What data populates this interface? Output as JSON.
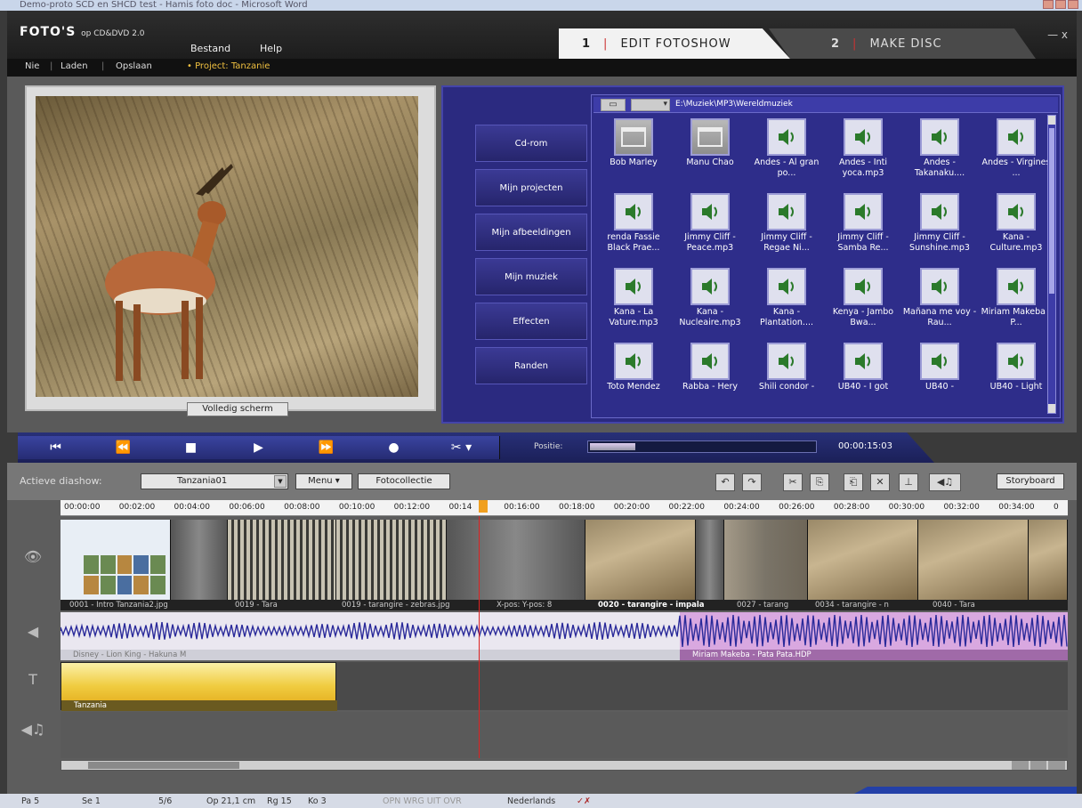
{
  "window": {
    "title": "Demo-proto SCD en SHCD test - Hamis foto doc - Microsoft Word"
  },
  "app": {
    "logo": "FOTO'S",
    "logo_sub": "op CD&DVD 2.0",
    "menu": [
      "Bestand",
      "Help"
    ],
    "tabs": [
      {
        "num": "1",
        "label": "EDIT FOTOSHOW"
      },
      {
        "num": "2",
        "label": "MAKE DISC"
      }
    ],
    "close_symbol": "— x",
    "subbar": {
      "nie": "Nie",
      "laden": "Laden",
      "opslaan": "Opslaan",
      "project": "• Project: Tanzanie"
    }
  },
  "preview": {
    "fullscreen_label": "Volledig scherm"
  },
  "browser": {
    "nav": [
      "Cd-rom",
      "Mijn projecten",
      "Mijn afbeeldingen",
      "Mijn muziek",
      "Effecten",
      "Randen"
    ],
    "path": "E:\\Muziek\\MP3\\Wereldmuziek",
    "folder_btn": "▭",
    "drop_btn": "▾",
    "items": [
      {
        "label": "Bob Marley",
        "type": "folder"
      },
      {
        "label": "Manu Chao",
        "type": "folder"
      },
      {
        "label": "Andes - Al gran po...",
        "type": "audio"
      },
      {
        "label": "Andes - Inti yoca.mp3",
        "type": "audio"
      },
      {
        "label": "Andes - Takanaku....",
        "type": "audio"
      },
      {
        "label": "Andes - Virgines ...",
        "type": "audio"
      },
      {
        "label": "renda Fassie Black Prae...",
        "type": "audio"
      },
      {
        "label": "Jimmy Cliff - Peace.mp3",
        "type": "audio"
      },
      {
        "label": "Jimmy Cliff - Regae Ni...",
        "type": "audio"
      },
      {
        "label": "Jimmy Cliff - Samba Re...",
        "type": "audio"
      },
      {
        "label": "Jimmy Cliff - Sunshine.mp3",
        "type": "audio"
      },
      {
        "label": "Kana - Culture.mp3",
        "type": "audio"
      },
      {
        "label": "Kana - La Vature.mp3",
        "type": "audio"
      },
      {
        "label": "Kana - Nucleaire.mp3",
        "type": "audio"
      },
      {
        "label": "Kana - Plantation....",
        "type": "audio"
      },
      {
        "label": "Kenya - Jambo Bwa...",
        "type": "audio"
      },
      {
        "label": "Mañana me voy - Rau...",
        "type": "audio"
      },
      {
        "label": "Miriam Makeba - P...",
        "type": "audio"
      },
      {
        "label": "Toto Mendez",
        "type": "audio"
      },
      {
        "label": "Rabba - Hery",
        "type": "audio"
      },
      {
        "label": "Shili condor -",
        "type": "audio"
      },
      {
        "label": "UB40 - I got",
        "type": "audio"
      },
      {
        "label": "UB40 -",
        "type": "audio"
      },
      {
        "label": "UB40 - Light",
        "type": "audio"
      }
    ]
  },
  "transport": {
    "buttons": [
      "⏮",
      "⏪",
      "■",
      "▶",
      "⏩",
      "●",
      "✂ ▾"
    ],
    "position_label": "Positie:",
    "position_fraction": 0.2,
    "time": "00:00:15:03"
  },
  "editor": {
    "title": "Actieve diashow:",
    "slideshow": "Tanzania01",
    "dd_symbol": "▼",
    "menu_btn": "Menu ▾",
    "collection_btn": "Fotocollectie",
    "tools": [
      "↶",
      "↷",
      "✂",
      "⎘",
      "⎗",
      "✕",
      "⊥",
      "◀♫"
    ],
    "storyboard_btn": "Storyboard",
    "ruler": [
      "00:00:00",
      "00:02:00",
      "00:04:00",
      "00:06:00",
      "00:08:00",
      "00:10:00",
      "00:12:00",
      "00:14",
      "00:16:00",
      "00:18:00",
      "00:20:00",
      "00:22:00",
      "00:24:00",
      "00:26:00",
      "00:28:00",
      "00:30:00",
      "00:32:00",
      "00:34:00",
      "0"
    ],
    "clip_captions": [
      "0001 - Intro Tanzania2.jpg",
      "0019 - Tara",
      "0019 - tarangire - zebras.jpg",
      "X-pos: Y-pos: 8",
      "0020 - tarangire - impala",
      "0027 - tarang",
      "0034 - tarangire - n",
      "0040 - Tara"
    ],
    "audio_captions": [
      "Disney - Lion King - Hakuna M",
      "Miriam Makeba - Pata Pata.HDP"
    ],
    "title_clip": "Tanzania",
    "side_icons": [
      "eye-icon",
      "speaker-icon",
      "text-icon",
      "music-icon"
    ]
  },
  "status": {
    "pa": "Pa 5",
    "se": "Se 1",
    "pages": "5/6",
    "op": "Op 21,1 cm",
    "rg": "Rg 15",
    "ko": "Ko 3",
    "modes": "OPN  WRG  UIT  OVR",
    "lang": "Nederlands"
  }
}
